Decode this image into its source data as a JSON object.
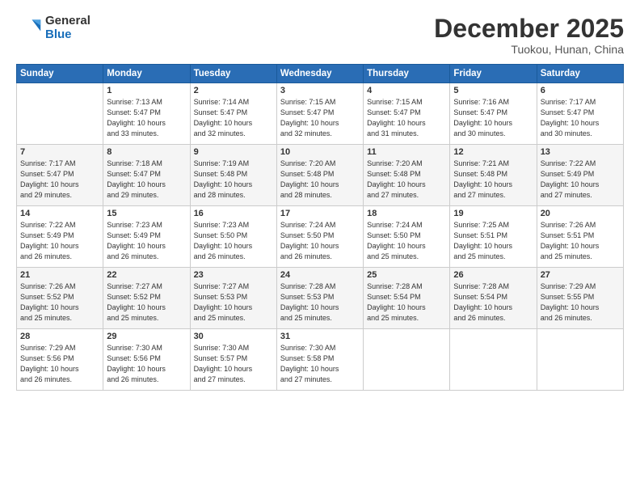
{
  "logo": {
    "general": "General",
    "blue": "Blue"
  },
  "title": "December 2025",
  "subtitle": "Tuokou, Hunan, China",
  "headers": [
    "Sunday",
    "Monday",
    "Tuesday",
    "Wednesday",
    "Thursday",
    "Friday",
    "Saturday"
  ],
  "weeks": [
    [
      {
        "day": "",
        "info": ""
      },
      {
        "day": "1",
        "info": "Sunrise: 7:13 AM\nSunset: 5:47 PM\nDaylight: 10 hours\nand 33 minutes."
      },
      {
        "day": "2",
        "info": "Sunrise: 7:14 AM\nSunset: 5:47 PM\nDaylight: 10 hours\nand 32 minutes."
      },
      {
        "day": "3",
        "info": "Sunrise: 7:15 AM\nSunset: 5:47 PM\nDaylight: 10 hours\nand 32 minutes."
      },
      {
        "day": "4",
        "info": "Sunrise: 7:15 AM\nSunset: 5:47 PM\nDaylight: 10 hours\nand 31 minutes."
      },
      {
        "day": "5",
        "info": "Sunrise: 7:16 AM\nSunset: 5:47 PM\nDaylight: 10 hours\nand 30 minutes."
      },
      {
        "day": "6",
        "info": "Sunrise: 7:17 AM\nSunset: 5:47 PM\nDaylight: 10 hours\nand 30 minutes."
      }
    ],
    [
      {
        "day": "7",
        "info": "Sunrise: 7:17 AM\nSunset: 5:47 PM\nDaylight: 10 hours\nand 29 minutes."
      },
      {
        "day": "8",
        "info": "Sunrise: 7:18 AM\nSunset: 5:47 PM\nDaylight: 10 hours\nand 29 minutes."
      },
      {
        "day": "9",
        "info": "Sunrise: 7:19 AM\nSunset: 5:48 PM\nDaylight: 10 hours\nand 28 minutes."
      },
      {
        "day": "10",
        "info": "Sunrise: 7:20 AM\nSunset: 5:48 PM\nDaylight: 10 hours\nand 28 minutes."
      },
      {
        "day": "11",
        "info": "Sunrise: 7:20 AM\nSunset: 5:48 PM\nDaylight: 10 hours\nand 27 minutes."
      },
      {
        "day": "12",
        "info": "Sunrise: 7:21 AM\nSunset: 5:48 PM\nDaylight: 10 hours\nand 27 minutes."
      },
      {
        "day": "13",
        "info": "Sunrise: 7:22 AM\nSunset: 5:49 PM\nDaylight: 10 hours\nand 27 minutes."
      }
    ],
    [
      {
        "day": "14",
        "info": "Sunrise: 7:22 AM\nSunset: 5:49 PM\nDaylight: 10 hours\nand 26 minutes."
      },
      {
        "day": "15",
        "info": "Sunrise: 7:23 AM\nSunset: 5:49 PM\nDaylight: 10 hours\nand 26 minutes."
      },
      {
        "day": "16",
        "info": "Sunrise: 7:23 AM\nSunset: 5:50 PM\nDaylight: 10 hours\nand 26 minutes."
      },
      {
        "day": "17",
        "info": "Sunrise: 7:24 AM\nSunset: 5:50 PM\nDaylight: 10 hours\nand 26 minutes."
      },
      {
        "day": "18",
        "info": "Sunrise: 7:24 AM\nSunset: 5:50 PM\nDaylight: 10 hours\nand 25 minutes."
      },
      {
        "day": "19",
        "info": "Sunrise: 7:25 AM\nSunset: 5:51 PM\nDaylight: 10 hours\nand 25 minutes."
      },
      {
        "day": "20",
        "info": "Sunrise: 7:26 AM\nSunset: 5:51 PM\nDaylight: 10 hours\nand 25 minutes."
      }
    ],
    [
      {
        "day": "21",
        "info": "Sunrise: 7:26 AM\nSunset: 5:52 PM\nDaylight: 10 hours\nand 25 minutes."
      },
      {
        "day": "22",
        "info": "Sunrise: 7:27 AM\nSunset: 5:52 PM\nDaylight: 10 hours\nand 25 minutes."
      },
      {
        "day": "23",
        "info": "Sunrise: 7:27 AM\nSunset: 5:53 PM\nDaylight: 10 hours\nand 25 minutes."
      },
      {
        "day": "24",
        "info": "Sunrise: 7:28 AM\nSunset: 5:53 PM\nDaylight: 10 hours\nand 25 minutes."
      },
      {
        "day": "25",
        "info": "Sunrise: 7:28 AM\nSunset: 5:54 PM\nDaylight: 10 hours\nand 25 minutes."
      },
      {
        "day": "26",
        "info": "Sunrise: 7:28 AM\nSunset: 5:54 PM\nDaylight: 10 hours\nand 26 minutes."
      },
      {
        "day": "27",
        "info": "Sunrise: 7:29 AM\nSunset: 5:55 PM\nDaylight: 10 hours\nand 26 minutes."
      }
    ],
    [
      {
        "day": "28",
        "info": "Sunrise: 7:29 AM\nSunset: 5:56 PM\nDaylight: 10 hours\nand 26 minutes."
      },
      {
        "day": "29",
        "info": "Sunrise: 7:30 AM\nSunset: 5:56 PM\nDaylight: 10 hours\nand 26 minutes."
      },
      {
        "day": "30",
        "info": "Sunrise: 7:30 AM\nSunset: 5:57 PM\nDaylight: 10 hours\nand 27 minutes."
      },
      {
        "day": "31",
        "info": "Sunrise: 7:30 AM\nSunset: 5:58 PM\nDaylight: 10 hours\nand 27 minutes."
      },
      {
        "day": "",
        "info": ""
      },
      {
        "day": "",
        "info": ""
      },
      {
        "day": "",
        "info": ""
      }
    ]
  ]
}
